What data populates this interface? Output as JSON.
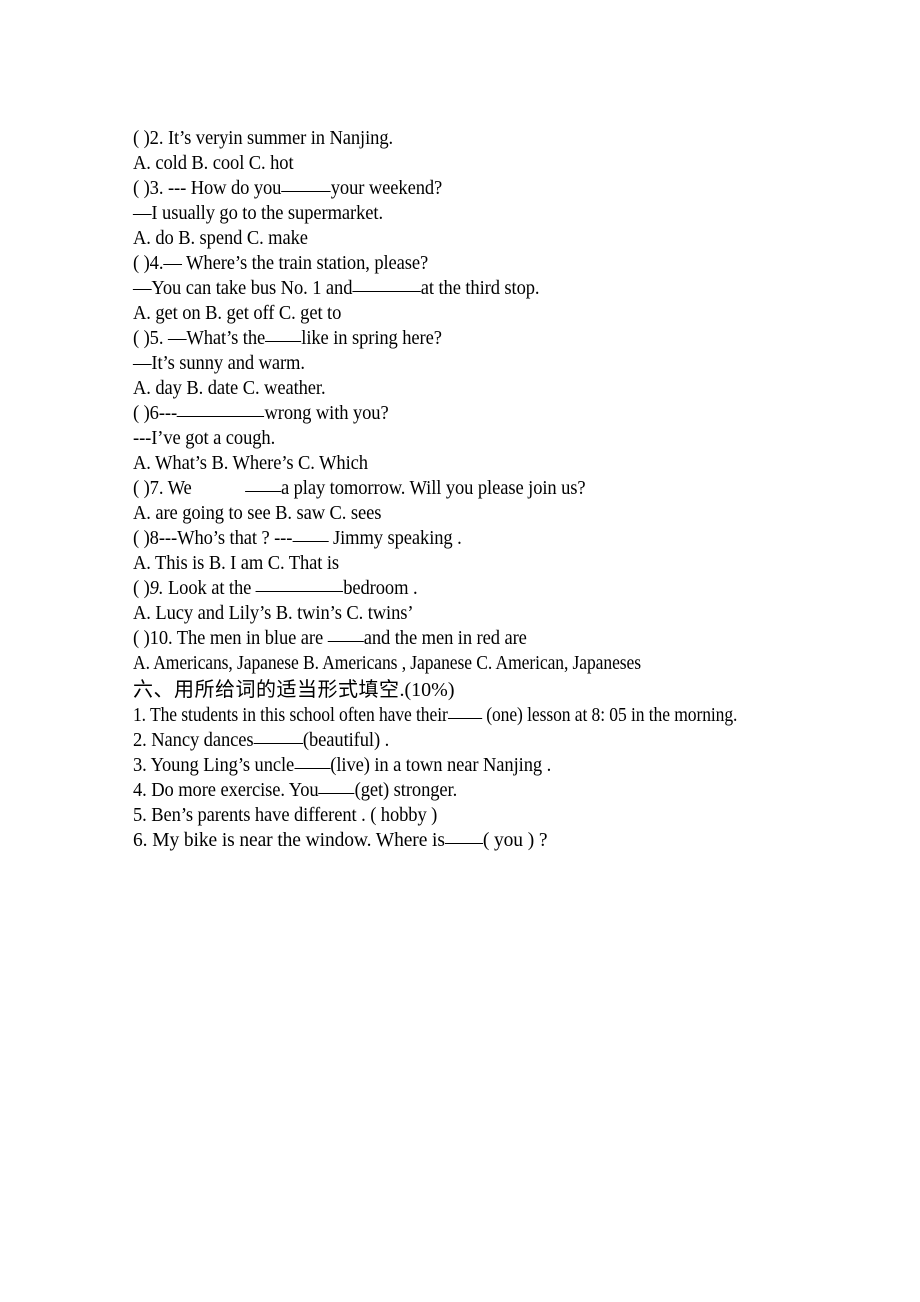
{
  "document": {
    "type": "english-exam-worksheet",
    "background_color": "#ffffff",
    "text_color": "#000000"
  },
  "multiple_choice": {
    "questions": [
      {
        "marker": "( )2.",
        "stem": "It’s veryin summer in Nanjing.",
        "options_line": "A. cold   B. cool        C. hot"
      },
      {
        "marker": "( )3.",
        "stem_pre": "--- How do you",
        "stem_post": "your weekend?",
        "answer_line": "—I usually go to the supermarket.",
        "options_line": "A. do   B. spend        C. make"
      },
      {
        "marker": "( )4.",
        "stem": "—  Where’s the train station, please?",
        "answer_pre": "—You can take bus No. 1 and",
        "answer_post": "at the third stop.",
        "options_line": "A. get on        B. get off       C. get to"
      },
      {
        "marker": "( )5.",
        "stem_pre": "—What’s the",
        "stem_post": "like in spring here?",
        "answer_line": "—It’s sunny and warm.",
        "options_line": "A. day  B. date  C. weather."
      },
      {
        "marker": "(  )6---",
        "stem_post": "wrong with you?",
        "answer_line": "---I’ve got a cough.",
        "options_line": "A. What’s        B. Where’s      C. Which"
      },
      {
        "marker": "( )7.",
        "stem_pre": "We",
        "stem_post": "a play tomorrow. Will you please join us?",
        "options_line": "A. are going to see   B. saw     C. sees"
      },
      {
        "marker": "( )8---",
        "stem_pre": "Who’s that ? ---",
        "stem_post": "Jimmy speaking .",
        "options_line": "A. This is        B. I am     C. That is"
      },
      {
        "marker": "( )",
        "number_italic": "9.",
        "stem_pre": "Look at the",
        "stem_post": "bedroom .",
        "options_line": "A. Lucy and Lily’s    B. twin’s    C. twins’"
      },
      {
        "marker": "( )10.",
        "stem_pre": "The men in blue are",
        "stem_post": "and the men in red are",
        "options_line": "A. Americans, Japanese   B. Americans , Japanese C. American, Japaneses"
      }
    ]
  },
  "section_six": {
    "heading_cn": "六、用所给词的适当形式填空",
    "heading_points": ".(10%)",
    "items": [
      {
        "number": "1.",
        "pre": "The students in this school often have their",
        "post": " (one) lesson at 8: 05 in the morning."
      },
      {
        "number": "2.",
        "pre": "Nancy dances",
        "post": "(beautiful) ."
      },
      {
        "number": "3.",
        "pre": " Young Ling’s uncle",
        "post": "(live) in a town near Nanjing ."
      },
      {
        "number": "4.",
        "pre": "Do more exercise. You",
        "post": "(get) stronger."
      },
      {
        "number": "5.",
        "pre": "Ben’s parents have different . ( hobby )",
        "post": ""
      },
      {
        "number": "6.",
        "pre": " My bike is near the window. Where is",
        "post": "( you ) ?"
      }
    ]
  }
}
